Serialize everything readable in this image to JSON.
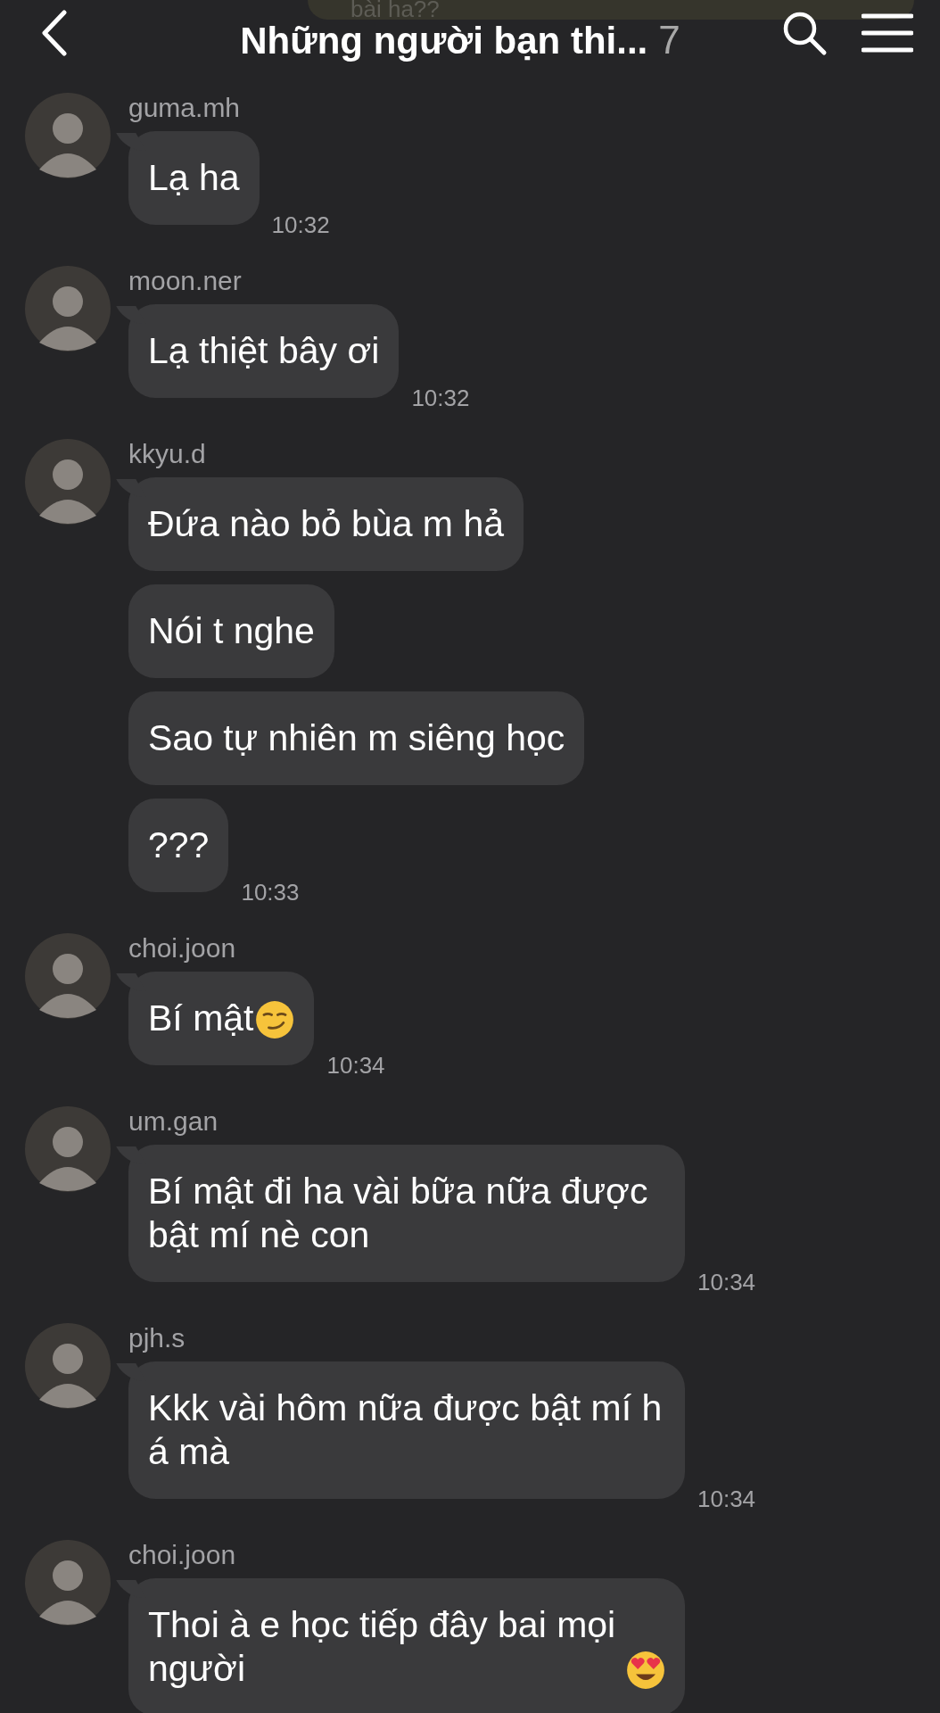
{
  "header": {
    "title": "Những người bạn thi...",
    "member_count": "7",
    "preview": "bài ha??"
  },
  "groups": [
    {
      "sender": "guma.mh",
      "time": "10:32",
      "messages": [
        {
          "kind": "text",
          "text": "Lạ ha"
        }
      ]
    },
    {
      "sender": "moon.ner",
      "time": "10:32",
      "messages": [
        {
          "kind": "text",
          "text": "Lạ thiệt bây ơi"
        }
      ]
    },
    {
      "sender": "kkyu.d",
      "time": "10:33",
      "messages": [
        {
          "kind": "text",
          "text": "Đứa nào bỏ bùa m hả"
        },
        {
          "kind": "text",
          "text": "Nói t nghe"
        },
        {
          "kind": "text",
          "text": "Sao tự nhiên m siêng học"
        },
        {
          "kind": "text",
          "text": "???"
        }
      ]
    },
    {
      "sender": "choi.joon",
      "time": "10:34",
      "messages": [
        {
          "kind": "smirk",
          "text": "Bí mật"
        }
      ]
    },
    {
      "sender": "um.gan",
      "time": "10:34",
      "messages": [
        {
          "kind": "text",
          "text": "Bí mật đi ha vài bữa nữa được bật mí nè con"
        }
      ]
    },
    {
      "sender": "pjh.s",
      "time": "10:34",
      "messages": [
        {
          "kind": "text",
          "text": "Kkk vài hôm nữa được bật mí h á mà"
        }
      ]
    },
    {
      "sender": "choi.joon",
      "messages": [
        {
          "kind": "heart-eyes",
          "text": "Thoi à e học tiếp đây bai mọi người"
        }
      ]
    }
  ]
}
